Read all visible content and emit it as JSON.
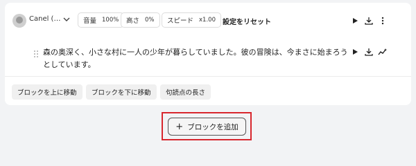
{
  "toolbar": {
    "voice_name": "Canel (…",
    "volume_label": "音量",
    "volume_value": "100%",
    "pitch_label": "高さ",
    "pitch_value": "0%",
    "speed_label": "スピード",
    "speed_value": "x1.00",
    "reset_label": "設定をリセット"
  },
  "block": {
    "text": "森の奥深く、小さな村に一人の少年が暮らしていました。彼の冒険は、今まさに始まろうとしています。"
  },
  "actions": {
    "move_up": "ブロックを上に移動",
    "move_down": "ブロックを下に移動",
    "pause_length": "句読点の長さ"
  },
  "add_block": {
    "icon": "+",
    "label": "ブロックを追加"
  },
  "colors": {
    "highlight": "#d8262d",
    "background": "#f2f3f5",
    "card": "#ffffff"
  },
  "icons": [
    "avatar",
    "chevron-down-icon",
    "play-icon",
    "download-icon",
    "more-vertical-icon",
    "drag-handle-icon",
    "sparkle-wave-icon",
    "plus-icon"
  ]
}
